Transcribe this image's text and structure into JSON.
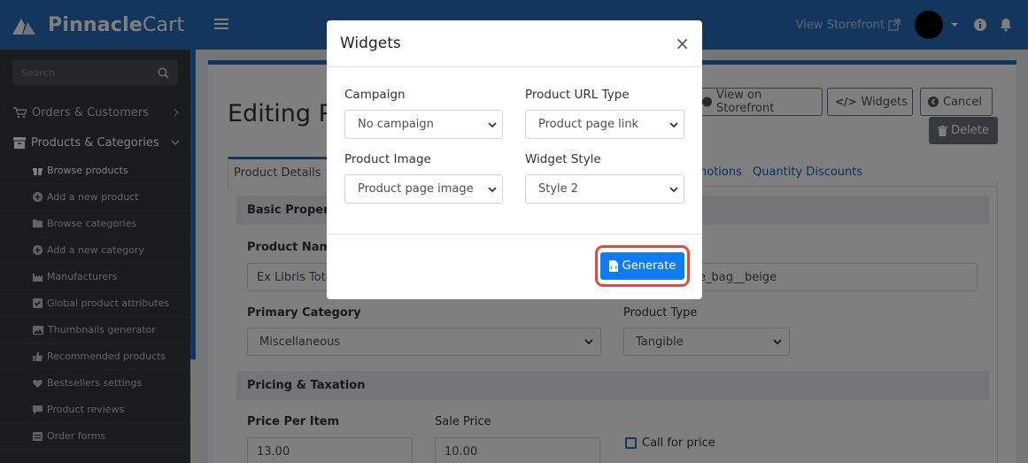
{
  "brand": {
    "name_bold": "Pinnacle",
    "name_light": "Cart"
  },
  "sidebar": {
    "search_placeholder": "Search",
    "sections": [
      {
        "label": "Orders & Customers",
        "icon": "cart-icon"
      },
      {
        "label": "Products & Categories",
        "icon": "archive-icon"
      }
    ],
    "items": [
      {
        "label": "Browse products",
        "icon": "gift-icon"
      },
      {
        "label": "Add a new product",
        "icon": "plus-circle-icon"
      },
      {
        "label": "Browse categories",
        "icon": "folder-icon"
      },
      {
        "label": "Add a new category",
        "icon": "plus-circle-icon"
      },
      {
        "label": "Manufacturers",
        "icon": "industry-icon"
      },
      {
        "label": "Global product attributes",
        "icon": "check-square-icon"
      },
      {
        "label": "Thumbnails generator",
        "icon": "image-icon"
      },
      {
        "label": "Recommended products",
        "icon": "thumbs-up-icon"
      },
      {
        "label": "Bestsellers settings",
        "icon": "heart-icon"
      },
      {
        "label": "Product reviews",
        "icon": "comment-icon"
      },
      {
        "label": "Order forms",
        "icon": "form-icon"
      }
    ]
  },
  "topbar": {
    "view_storefront": "View Storefront"
  },
  "page": {
    "title": "Editing P",
    "buttons": {
      "view_on_storefront": "View on Storefront",
      "widgets": "Widgets",
      "cancel": "Cancel",
      "delete": "Delete"
    },
    "tabs": {
      "product_details": "Product Details",
      "promotions": "notions",
      "quantity_discounts": "Quantity Discounts"
    },
    "basic_properties": "Basic Propertie",
    "product_name_label": "Product Nam",
    "product_name_value": "Ex Libris Tote",
    "product_id_value": "e_bag__beige",
    "primary_category_label": "Primary Category",
    "primary_category_value": "Miscellaneous",
    "product_type_label": "Product Type",
    "product_type_value": "Tangible",
    "pricing_heading": "Pricing & Taxation",
    "price_label": "Price Per Item",
    "price_value": "13.00",
    "sale_label": "Sale Price",
    "sale_value": "10.00",
    "call_for_price": "Call for price"
  },
  "modal": {
    "title": "Widgets",
    "close": "×",
    "campaign_label": "Campaign",
    "campaign_value": "No campaign",
    "url_type_label": "Product URL Type",
    "url_type_value": "Product page link",
    "image_label": "Product Image",
    "image_value": "Product page image",
    "style_label": "Widget Style",
    "style_value": "Style 2",
    "generate_label": "Generate"
  },
  "colors": {
    "brand_blue": "#2b6cb8",
    "sidebar_bg": "#343a40",
    "primary_button": "#0d7cf2",
    "highlight_ring": "#d9503f"
  }
}
